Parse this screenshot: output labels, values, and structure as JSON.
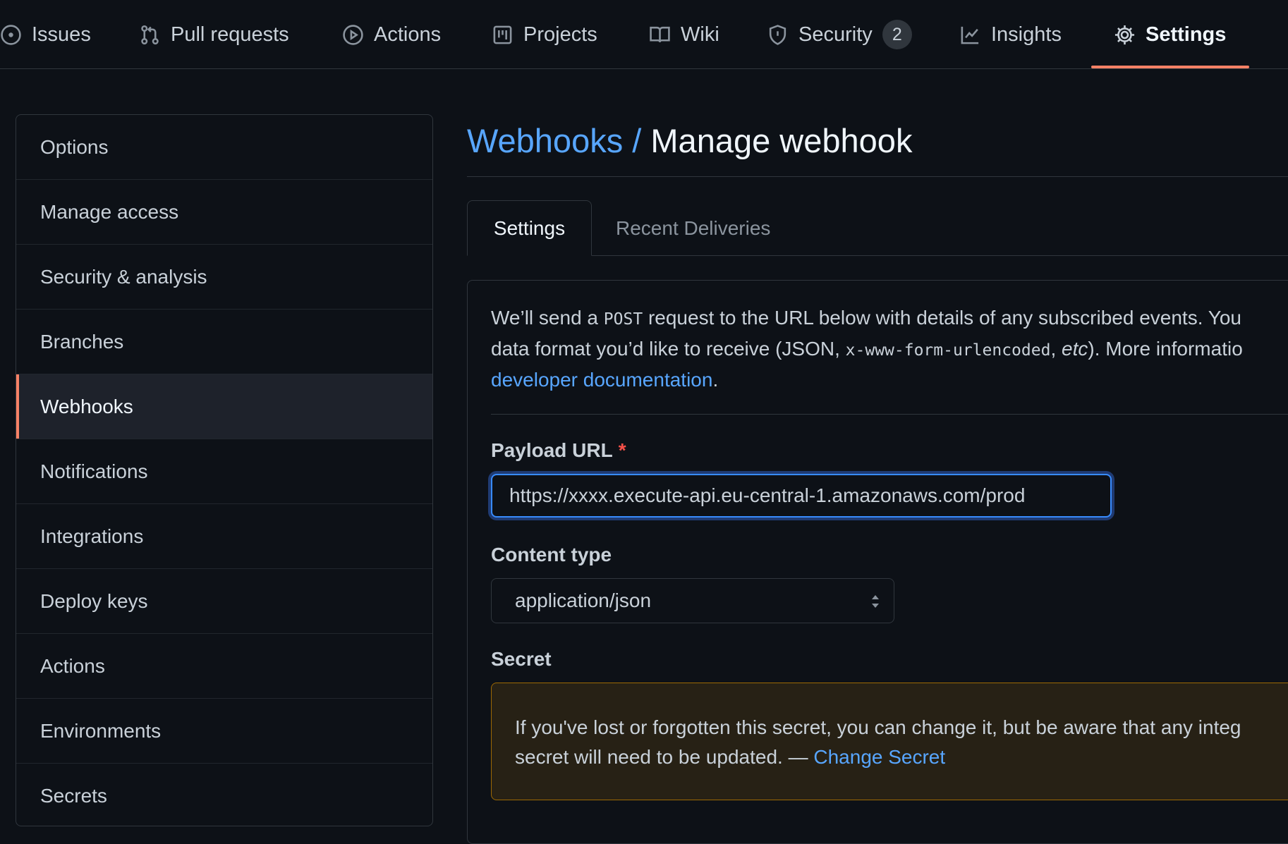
{
  "nav": {
    "tabs": [
      {
        "label": "Issues",
        "icon": "issue-icon"
      },
      {
        "label": "Pull requests",
        "icon": "pull-request-icon"
      },
      {
        "label": "Actions",
        "icon": "play-icon"
      },
      {
        "label": "Projects",
        "icon": "project-icon"
      },
      {
        "label": "Wiki",
        "icon": "book-icon"
      },
      {
        "label": "Security",
        "icon": "shield-icon",
        "count": "2"
      },
      {
        "label": "Insights",
        "icon": "graph-icon"
      },
      {
        "label": "Settings",
        "icon": "gear-icon",
        "active": true
      }
    ]
  },
  "sidebar": {
    "items": [
      {
        "label": "Options"
      },
      {
        "label": "Manage access"
      },
      {
        "label": "Security & analysis"
      },
      {
        "label": "Branches"
      },
      {
        "label": "Webhooks",
        "selected": true
      },
      {
        "label": "Notifications"
      },
      {
        "label": "Integrations"
      },
      {
        "label": "Deploy keys"
      },
      {
        "label": "Actions"
      },
      {
        "label": "Environments"
      },
      {
        "label": "Secrets"
      }
    ]
  },
  "header": {
    "crumb": "Webhooks",
    "separator": " / ",
    "current": "Manage webhook"
  },
  "tabs": {
    "settings": "Settings",
    "deliveries": "Recent Deliveries"
  },
  "intro": {
    "line1_a": "We’ll send a ",
    "line1_code": "POST",
    "line1_b": " request to the URL below with details of any subscribed events. You",
    "line2_a": "data format you’d like to receive (JSON, ",
    "line2_code": "x-www-form-urlencoded",
    "line2_b": ", ",
    "line2_em": "etc",
    "line2_c": "). More informatio",
    "link": "developer documentation",
    "after_link": "."
  },
  "form": {
    "payload_label": "Payload URL",
    "required_mark": "*",
    "payload_value": "https://xxxx.execute-api.eu-central-1.amazonaws.com/prod",
    "content_type_label": "Content type",
    "content_type_value": "application/json",
    "secret_label": "Secret",
    "secret_warning_line1": "If you've lost or forgotten this secret, you can change it, but be aware that any integ",
    "secret_warning_line2": "secret will need to be updated. — ",
    "change_secret_link": "Change Secret"
  },
  "colors": {
    "accent_underline": "#f78166",
    "link": "#58a6ff",
    "focus_ring": "#388bfd",
    "warning_border": "#9e6a03"
  }
}
